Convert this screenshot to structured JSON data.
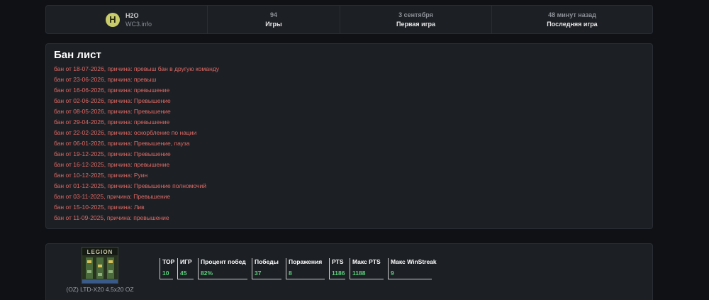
{
  "player": {
    "avatar_letter": "H",
    "name": "H2O",
    "server": "WC3.info"
  },
  "top_stats": [
    {
      "value": "94",
      "label": "Игры"
    },
    {
      "value": "3 сентября",
      "label": "Первая игра"
    },
    {
      "value": "48 минут назад",
      "label": "Последняя игра"
    }
  ],
  "ban_list": {
    "title": "Бан лист",
    "items": [
      "бан от 18-07-2026, причина: превыш бан в другую команду",
      "бан от 23-06-2026, причина: превыш",
      "бан от 16-06-2026, причина: превышение",
      "бан от 02-06-2026, причина: Превышение",
      "бан от 08-05-2026, причина: Превышение",
      "бан от 29-04-2026, причина: превышение",
      "бан от 22-02-2026, причина: оскорбление по нации",
      "бан от 06-01-2026, причина: Превышение, пауза",
      "бан от 19-12-2025, причина: Превышение",
      "бан от 16-12-2025, причина: превышение",
      "бан от 10-12-2025, причина: Руин",
      "бан от 01-12-2025, причина: Превышение полномочий",
      "бан от 03-11-2025, причина: Превышение",
      "бан от 15-10-2025, причина: Лив",
      "бан от 11-09-2025, причина: превышение"
    ]
  },
  "mode": {
    "icon_text": "LEGION",
    "name": "(OZ) LTD-X20 4.5x20 OZ",
    "stats": [
      {
        "label": "TOP",
        "value": "10"
      },
      {
        "label": "ИГР",
        "value": "45"
      },
      {
        "label": "Процент побед",
        "value": "82%"
      },
      {
        "label": "Победы",
        "value": "37"
      },
      {
        "label": "Поражения",
        "value": "8"
      },
      {
        "label": "PTS",
        "value": "1186"
      },
      {
        "label": "Макс PTS",
        "value": "1188"
      },
      {
        "label": "Макс WinStreak",
        "value": "9"
      }
    ]
  },
  "colors": {
    "ban_text": "#e06a65",
    "stat_value": "#5cd37c",
    "avatar_bg": "#c8cc6a"
  }
}
